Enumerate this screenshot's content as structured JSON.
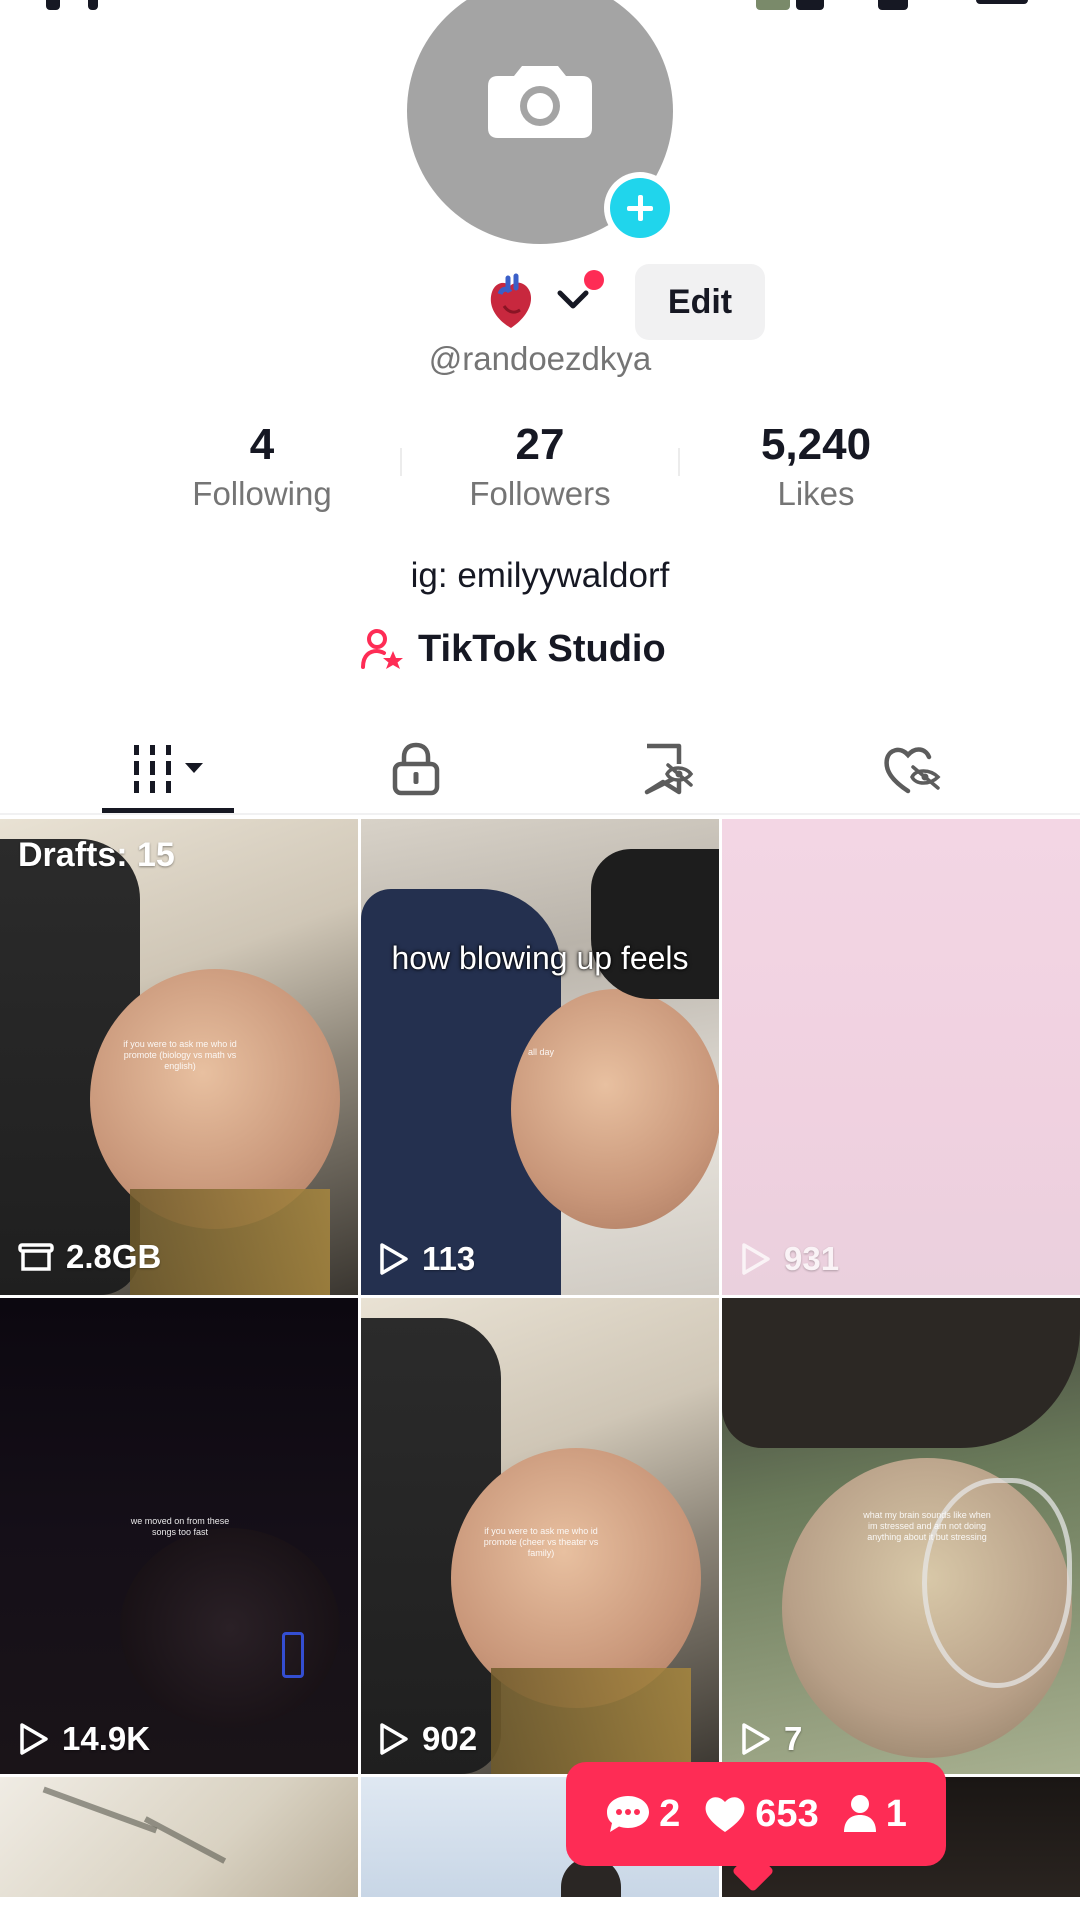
{
  "profile": {
    "username": "@randoezdkya",
    "edit_label": "Edit",
    "bio": "ig: emilyywaldorf",
    "studio_label": "TikTok Studio"
  },
  "stats": [
    {
      "value": "4",
      "label": "Following"
    },
    {
      "value": "27",
      "label": "Followers"
    },
    {
      "value": "5,240",
      "label": "Likes"
    }
  ],
  "tabs": [
    {
      "icon": "videos-grid-icon",
      "selected": true
    },
    {
      "icon": "lock-icon",
      "selected": false
    },
    {
      "icon": "bookmark-hidden-icon",
      "selected": false
    },
    {
      "icon": "liked-hidden-icon",
      "selected": false
    }
  ],
  "grid": {
    "drafts_label": "Drafts: 15",
    "tiles": [
      {
        "stat": "2.8GB",
        "stat_icon": "drafts-box-icon",
        "tiny_text": "if you were to ask me who id promote (biology vs math vs english)"
      },
      {
        "stat": "113",
        "stat_icon": "play-icon",
        "overlay_text": "how blowing up feels",
        "tiny_text": "all day"
      },
      {
        "stat": "931",
        "stat_icon": "play-icon"
      },
      {
        "stat": "14.9K",
        "stat_icon": "play-icon",
        "tiny_text": "we moved on from these songs too fast"
      },
      {
        "stat": "902",
        "stat_icon": "play-icon",
        "tiny_text": "if you were to ask me who id promote (cheer vs theater vs family)"
      },
      {
        "stat": "7",
        "stat_icon": "play-icon",
        "tiny_text": "what my brain sounds like when im stressed and am not doing anything about it but stressing"
      }
    ]
  },
  "notification_bubble": {
    "comments": "2",
    "likes": "653",
    "followers": "1"
  },
  "colors": {
    "accent": "#fe2c55",
    "avatar_add": "#20d5ec",
    "text_primary": "#161823",
    "text_secondary": "#757575"
  }
}
